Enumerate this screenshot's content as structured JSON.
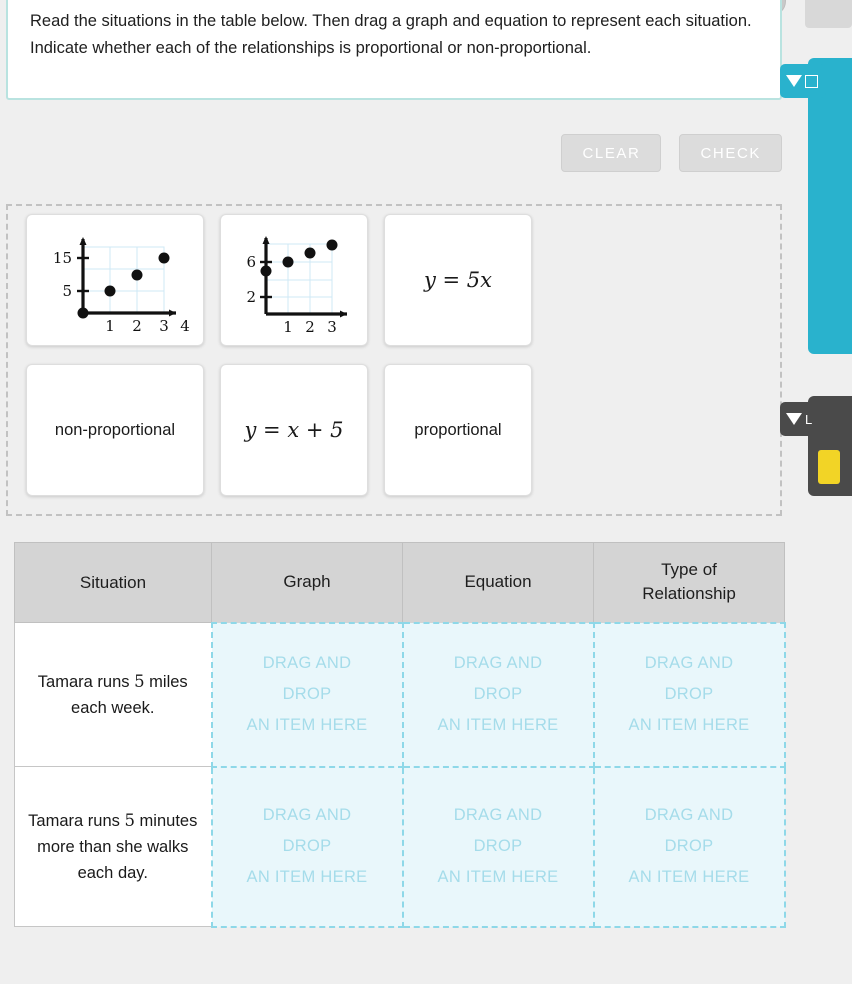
{
  "instruction": {
    "text": "Read the situations in the table below. Then drag a graph and equation to represent each situation. Indicate whether each of the relationships is proportional or non-proportional."
  },
  "toolbar": {
    "clear_label": "CLEAR",
    "check_label": "CHECK"
  },
  "tile_bank": {
    "tiles": [
      {
        "id": "graph-proportional",
        "type": "graph",
        "label": "graph with points (0,0), (1,5), (2,10), (3,15)"
      },
      {
        "id": "graph-nonproportional",
        "type": "graph",
        "label": "graph with points (0,5), (1,6), (2,7), (3,8)"
      },
      {
        "id": "equation-5x",
        "type": "equation",
        "lhs": "y",
        "op": " = ",
        "rhs": "5x",
        "text": "y = 5x"
      },
      {
        "id": "word-non-proportional",
        "type": "word",
        "text": "non-proportional"
      },
      {
        "id": "equation-x-plus-5",
        "type": "equation",
        "lhs": "y",
        "op": " = ",
        "rhs": "x + 5",
        "text": "y = x + 5"
      },
      {
        "id": "word-proportional",
        "type": "word",
        "text": "proportional"
      }
    ]
  },
  "table": {
    "headers": [
      "Situation",
      "Graph",
      "Equation",
      "Type of Relationship"
    ],
    "header_type_of": "Type of",
    "header_relationship": "Relationship",
    "dropzone_line1": "DRAG AND",
    "dropzone_line2": "DROP",
    "dropzone_line3": "AN ITEM HERE",
    "rows": [
      {
        "situation_pre": "Tamara runs ",
        "situation_num": "5",
        "situation_post": " miles each week.",
        "situation_full": "Tamara runs 5 miles each week."
      },
      {
        "situation_pre": "Tamara runs ",
        "situation_num": "5",
        "situation_post": " minutes more than she walks each day.",
        "situation_full": "Tamara runs 5 minutes more than she walks each day."
      }
    ]
  },
  "side_panels": {
    "teal": {
      "icon": "chevron-down-icon",
      "badge_icon": "window-icon"
    },
    "dark": {
      "icon": "chevron-down-icon",
      "label": "L"
    }
  },
  "colors": {
    "accent_teal": "#29b2cd",
    "panel_dark": "#4a4a4a",
    "dropzone_bg": "#e9f7fb",
    "dropzone_border": "#8ed8e8",
    "dropzone_text": "#a5dcea",
    "header_bg": "#d4d4d4",
    "page_bg": "#efefef",
    "instruction_border": "#b9e3e0",
    "highlight_yellow": "#f2d426"
  },
  "graphs": {
    "graph1": {
      "x_ticks": [
        "1",
        "2",
        "3",
        "4"
      ],
      "y_ticks": [
        "5",
        "15"
      ],
      "points": [
        [
          0,
          0
        ],
        [
          1,
          5
        ],
        [
          2,
          10
        ],
        [
          3,
          15
        ]
      ]
    },
    "graph2": {
      "x_ticks": [
        "1",
        "2",
        "3"
      ],
      "y_ticks": [
        "2",
        "6"
      ],
      "points": [
        [
          0,
          5
        ],
        [
          1,
          6
        ],
        [
          2,
          7
        ],
        [
          3,
          8
        ]
      ]
    }
  }
}
